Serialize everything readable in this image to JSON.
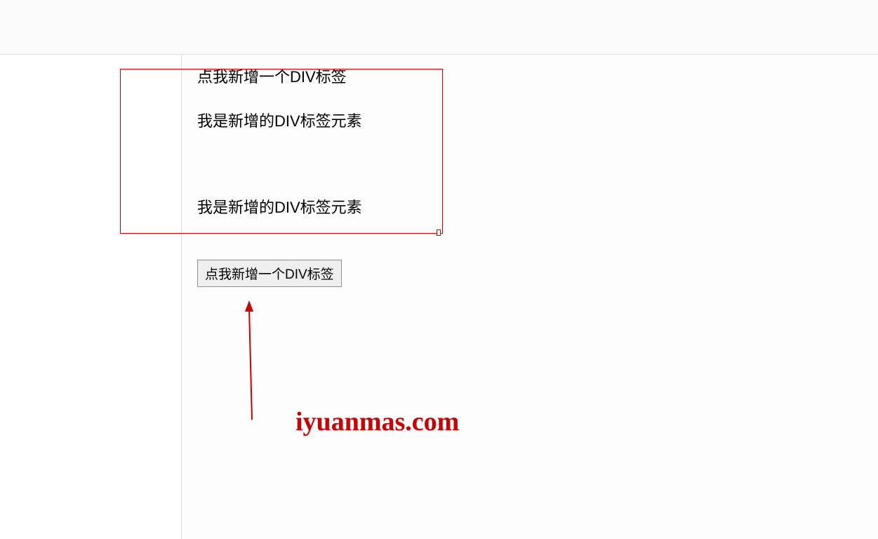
{
  "content": {
    "line1": "点我新增一个DIV标签",
    "line2": "我是新增的DIV标签元素",
    "line3": "我是新增的DIV标签元素"
  },
  "button": {
    "label": "点我新增一个DIV标签"
  },
  "watermark": {
    "text": "iyuanmas.com"
  },
  "annotation": {
    "highlight_color": "#cc0000"
  }
}
